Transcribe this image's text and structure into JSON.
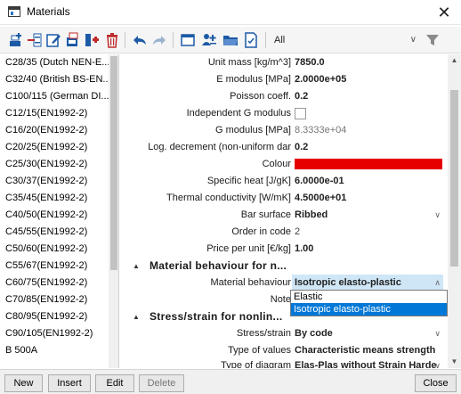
{
  "window": {
    "title": "Materials",
    "close_label": "✕"
  },
  "toolbar": {
    "filter_value": "All",
    "buttons": [
      {
        "name": "new-material-icon",
        "color": "#1c5aa6"
      },
      {
        "name": "insert-icon",
        "color": "#c02b2b"
      },
      {
        "name": "edit-icon",
        "color": "#1c5aa6"
      },
      {
        "name": "copy-icon",
        "color": "#c02b2b"
      },
      {
        "name": "add-row-icon",
        "color": "#c02b2b"
      },
      {
        "name": "delete-icon",
        "color": "#c02b2b"
      },
      {
        "name": "undo-icon",
        "color": "#1c5aa6"
      },
      {
        "name": "redo-icon",
        "color": "#9cb3d0"
      },
      {
        "name": "table-icon",
        "color": "#1c5aa6"
      },
      {
        "name": "user-settings-icon",
        "color": "#1c5aa6"
      },
      {
        "name": "open-folder-icon",
        "color": "#1c5aa6"
      },
      {
        "name": "document-check-icon",
        "color": "#1c5aa6"
      }
    ]
  },
  "materials": [
    "C28/35 (Dutch NEN-E...",
    "C32/40 (British BS-EN...",
    "C100/115 (German DI...",
    "C12/15(EN1992-2)",
    "C16/20(EN1992-2)",
    "C20/25(EN1992-2)",
    "C25/30(EN1992-2)",
    "C30/37(EN1992-2)",
    "C35/45(EN1992-2)",
    "C40/50(EN1992-2)",
    "C45/55(EN1992-2)",
    "C50/60(EN1992-2)",
    "C55/67(EN1992-2)",
    "C60/75(EN1992-2)",
    "C70/85(EN1992-2)",
    "C80/95(EN1992-2)",
    "C90/105(EN1992-2)",
    "B 500A"
  ],
  "properties": {
    "unit_mass": {
      "label": "Unit mass [kg/m^3]",
      "value": "7850.0"
    },
    "e_modulus": {
      "label": "E modulus [MPa]",
      "value": "2.0000e+05"
    },
    "poisson": {
      "label": "Poisson coeff.",
      "value": "0.2"
    },
    "independent_g": {
      "label": "Independent G modulus"
    },
    "g_modulus": {
      "label": "G modulus [MPa]",
      "value": "8.3333e+04"
    },
    "log_decrement": {
      "label": "Log. decrement (non-uniform dar",
      "value": "0.2"
    },
    "colour": {
      "label": "Colour",
      "value": "#e60000"
    },
    "specific_heat": {
      "label": "Specific heat [J/gK]",
      "value": "6.0000e-01"
    },
    "thermal_conductivity": {
      "label": "Thermal conductivity [W/mK]",
      "value": "4.5000e+01"
    },
    "bar_surface": {
      "label": "Bar surface",
      "value": "Ribbed"
    },
    "order_in_code": {
      "label": "Order in code",
      "value": "2"
    },
    "price_per_unit": {
      "label": "Price per unit [€/kg]",
      "value": "1.00"
    }
  },
  "section_material_behaviour": {
    "title": "Material behaviour for n...",
    "behaviour": {
      "label": "Material behaviour",
      "value": "Isotropic elasto-plastic"
    },
    "note": {
      "label": "Note"
    },
    "options": [
      "Elastic",
      "Isotropic elasto-plastic"
    ]
  },
  "section_stress_strain": {
    "title": "Stress/strain for nonlin...",
    "stress_strain": {
      "label": "Stress/strain",
      "value": "By code"
    },
    "type_of_values": {
      "label": "Type of values",
      "value": "Characteristic means strength"
    },
    "type_of_diagram": {
      "label": "Type of diagram",
      "value": "Elas-Plas without Strain Harde"
    }
  },
  "footer": {
    "new": "New",
    "insert": "Insert",
    "edit": "Edit",
    "delete": "Delete",
    "close": "Close"
  }
}
